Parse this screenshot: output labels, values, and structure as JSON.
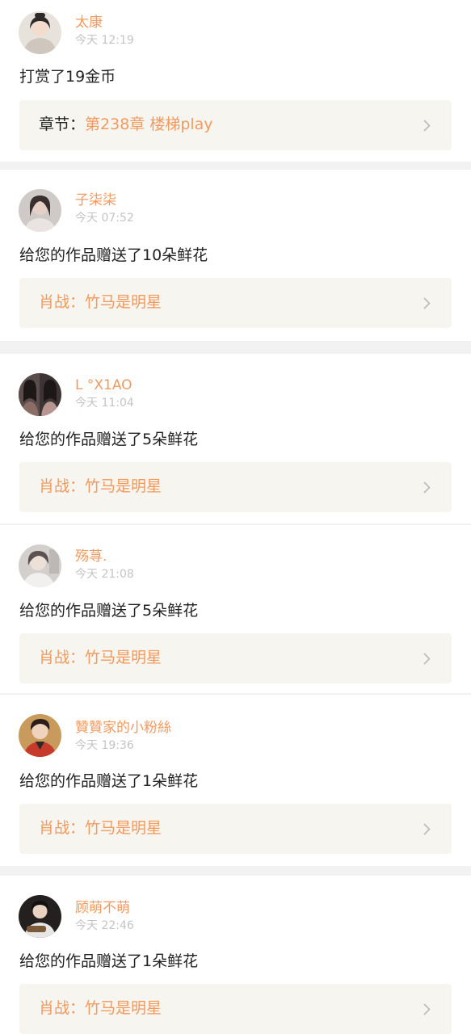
{
  "theme": {
    "accent": "#f19a5f",
    "text": "#222222",
    "muted": "#c4c4c4",
    "link_bg": "#f6f5ef",
    "separator": "#f2f2f2"
  },
  "items": [
    {
      "user": "太康",
      "time": "今天 12:19",
      "message": "打赏了19金币",
      "link_prefix": "章节：",
      "link_title": "第238章 楼梯play",
      "avatar_icon": "user-avatar-icon",
      "arrow_icon": "chevron-right-icon"
    },
    {
      "user": "子柒柒",
      "time": "今天 07:52",
      "message": "给您的作品赠送了10朵鲜花",
      "link_prefix": "肖战：",
      "link_title": "竹马是明星",
      "avatar_icon": "user-avatar-icon",
      "arrow_icon": "chevron-right-icon"
    },
    {
      "user": "L °X1AO",
      "time": "今天 11:04",
      "message": "给您的作品赠送了5朵鲜花",
      "link_prefix": "肖战：",
      "link_title": "竹马是明星",
      "avatar_icon": "user-avatar-icon",
      "arrow_icon": "chevron-right-icon"
    },
    {
      "user": "殇荨.",
      "time": "今天 21:08",
      "message": "给您的作品赠送了5朵鲜花",
      "link_prefix": "肖战：",
      "link_title": "竹马是明星",
      "avatar_icon": "user-avatar-icon",
      "arrow_icon": "chevron-right-icon"
    },
    {
      "user": "贊贊家的小粉絲",
      "time": "今天 19:36",
      "message": "给您的作品赠送了1朵鲜花",
      "link_prefix": "肖战：",
      "link_title": "竹马是明星",
      "avatar_icon": "user-avatar-icon",
      "arrow_icon": "chevron-right-icon"
    },
    {
      "user": "顾萌不萌",
      "time": "今天 22:46",
      "message": "给您的作品赠送了1朵鲜花",
      "link_prefix": "肖战：",
      "link_title": "竹马是明星",
      "avatar_icon": "user-avatar-icon",
      "arrow_icon": "chevron-right-icon"
    }
  ]
}
